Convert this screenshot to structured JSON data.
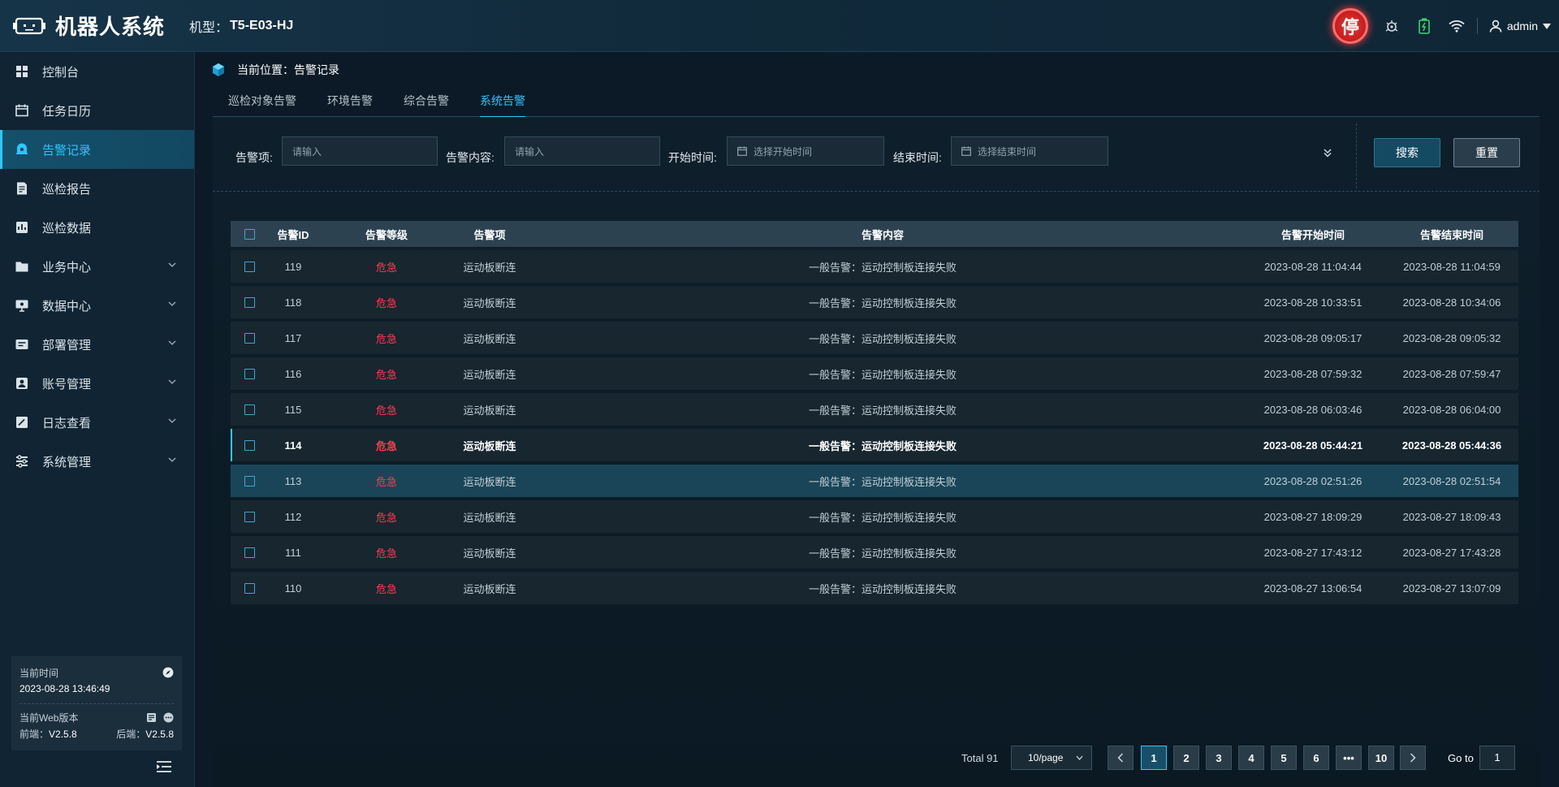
{
  "header": {
    "app_title": "机器人系统",
    "model_label": "机型：",
    "model_value": "T5-E03-HJ",
    "stop_label": "停",
    "username": "admin"
  },
  "sidebar": {
    "items": [
      {
        "label": "控制台",
        "icon": "dashboard-icon",
        "active": false,
        "has_children": false
      },
      {
        "label": "任务日历",
        "icon": "calendar-icon",
        "active": false,
        "has_children": false
      },
      {
        "label": "告警记录",
        "icon": "alarm-icon",
        "active": true,
        "has_children": false
      },
      {
        "label": "巡检报告",
        "icon": "report-icon",
        "active": false,
        "has_children": false
      },
      {
        "label": "巡检数据",
        "icon": "data-icon",
        "active": false,
        "has_children": false
      },
      {
        "label": "业务中心",
        "icon": "folder-icon",
        "active": false,
        "has_children": true
      },
      {
        "label": "数据中心",
        "icon": "monitor-icon",
        "active": false,
        "has_children": true
      },
      {
        "label": "部署管理",
        "icon": "deploy-icon",
        "active": false,
        "has_children": true
      },
      {
        "label": "账号管理",
        "icon": "account-icon",
        "active": false,
        "has_children": true
      },
      {
        "label": "日志查看",
        "icon": "log-icon",
        "active": false,
        "has_children": true
      },
      {
        "label": "系统管理",
        "icon": "settings-icon",
        "active": false,
        "has_children": true
      }
    ],
    "info": {
      "time_label": "当前时间",
      "time_value": "2023-08-28 13:46:49",
      "version_label": "当前Web版本",
      "frontend_label": "前端：",
      "frontend_value": "V2.5.8",
      "backend_label": "后端：",
      "backend_value": "V2.5.8"
    }
  },
  "breadcrumb": {
    "prefix": "当前位置：",
    "current": "告警记录"
  },
  "tabs": [
    {
      "label": "巡检对象告警",
      "active": false
    },
    {
      "label": "环境告警",
      "active": false
    },
    {
      "label": "综合告警",
      "active": false
    },
    {
      "label": "系统告警",
      "active": true
    }
  ],
  "filters": {
    "item_label": "告警项:",
    "item_placeholder": "请输入",
    "content_label": "告警内容:",
    "content_placeholder": "请输入",
    "start_label": "开始时间:",
    "start_placeholder": "选择开始时间",
    "end_label": "结束时间:",
    "end_placeholder": "选择结束时间",
    "search_button": "搜索",
    "reset_button": "重置"
  },
  "table": {
    "columns": [
      "告警ID",
      "告警等级",
      "告警项",
      "告警内容",
      "告警开始时间",
      "告警结束时间"
    ],
    "rows": [
      {
        "id": "119",
        "level": "危急",
        "item": "运动板断连",
        "content": "一般告警：运动控制板连接失败",
        "start": "2023-08-28 11:04:44",
        "end": "2023-08-28 11:04:59"
      },
      {
        "id": "118",
        "level": "危急",
        "item": "运动板断连",
        "content": "一般告警：运动控制板连接失败",
        "start": "2023-08-28 10:33:51",
        "end": "2023-08-28 10:34:06"
      },
      {
        "id": "117",
        "level": "危急",
        "item": "运动板断连",
        "content": "一般告警：运动控制板连接失败",
        "start": "2023-08-28 09:05:17",
        "end": "2023-08-28 09:05:32"
      },
      {
        "id": "116",
        "level": "危急",
        "item": "运动板断连",
        "content": "一般告警：运动控制板连接失败",
        "start": "2023-08-28 07:59:32",
        "end": "2023-08-28 07:59:47"
      },
      {
        "id": "115",
        "level": "危急",
        "item": "运动板断连",
        "content": "一般告警：运动控制板连接失败",
        "start": "2023-08-28 06:03:46",
        "end": "2023-08-28 06:04:00"
      },
      {
        "id": "114",
        "level": "危急",
        "item": "运动板断连",
        "content": "一般告警：运动控制板连接失败",
        "start": "2023-08-28 05:44:21",
        "end": "2023-08-28 05:44:36"
      },
      {
        "id": "113",
        "level": "危急",
        "item": "运动板断连",
        "content": "一般告警：运动控制板连接失败",
        "start": "2023-08-28 02:51:26",
        "end": "2023-08-28 02:51:54"
      },
      {
        "id": "112",
        "level": "危急",
        "item": "运动板断连",
        "content": "一般告警：运动控制板连接失败",
        "start": "2023-08-27 18:09:29",
        "end": "2023-08-27 18:09:43"
      },
      {
        "id": "111",
        "level": "危急",
        "item": "运动板断连",
        "content": "一般告警：运动控制板连接失败",
        "start": "2023-08-27 17:43:12",
        "end": "2023-08-27 17:43:28"
      },
      {
        "id": "110",
        "level": "危急",
        "item": "运动板断连",
        "content": "一般告警：运动控制板连接失败",
        "start": "2023-08-27 13:06:54",
        "end": "2023-08-27 13:07:09"
      }
    ],
    "hovered_row_id": "114",
    "selected_row_id": "113"
  },
  "pagination": {
    "total": "Total 91",
    "page_size": "10/page",
    "pages": [
      "1",
      "2",
      "3",
      "4",
      "5",
      "6",
      "•••",
      "10"
    ],
    "current_page": "1",
    "goto_label": "Go to",
    "goto_value": "1"
  },
  "colors": {
    "accent": "#2ec6ff",
    "danger": "#ff3b4f",
    "stop_red": "#e23a3a",
    "background": "#0b1a26"
  }
}
